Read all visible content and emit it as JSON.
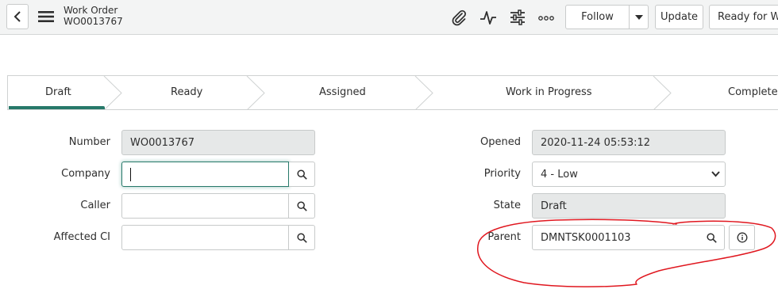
{
  "header": {
    "record_type": "Work Order",
    "record_number": "WO0013767",
    "icons": [
      "back-arrow-icon",
      "hamburger-menu-icon",
      "paperclip-icon",
      "activity-pulse-icon",
      "settings-sliders-icon",
      "more-options-icon"
    ],
    "buttons": {
      "follow": "Follow",
      "update": "Update",
      "ready_for_work": "Ready for Wo"
    }
  },
  "stages": {
    "items": [
      "Draft",
      "Ready",
      "Assigned",
      "Work in Progress",
      "Complete"
    ],
    "active": "Draft",
    "active_color": "#27796a"
  },
  "form": {
    "number": {
      "label": "Number",
      "value": "WO0013767"
    },
    "company": {
      "label": "Company",
      "value": ""
    },
    "caller": {
      "label": "Caller",
      "value": ""
    },
    "affected_ci": {
      "label": "Affected CI",
      "value": ""
    },
    "opened": {
      "label": "Opened",
      "value": "2020-11-24 05:53:12"
    },
    "priority": {
      "label": "Priority",
      "value": "4 - Low"
    },
    "state": {
      "label": "State",
      "value": "Draft"
    },
    "parent": {
      "label": "Parent",
      "value": "DMNTSK0001103"
    }
  },
  "annotation": {
    "color": "#e0171f",
    "shape": "hand-drawn circle around Parent field"
  }
}
